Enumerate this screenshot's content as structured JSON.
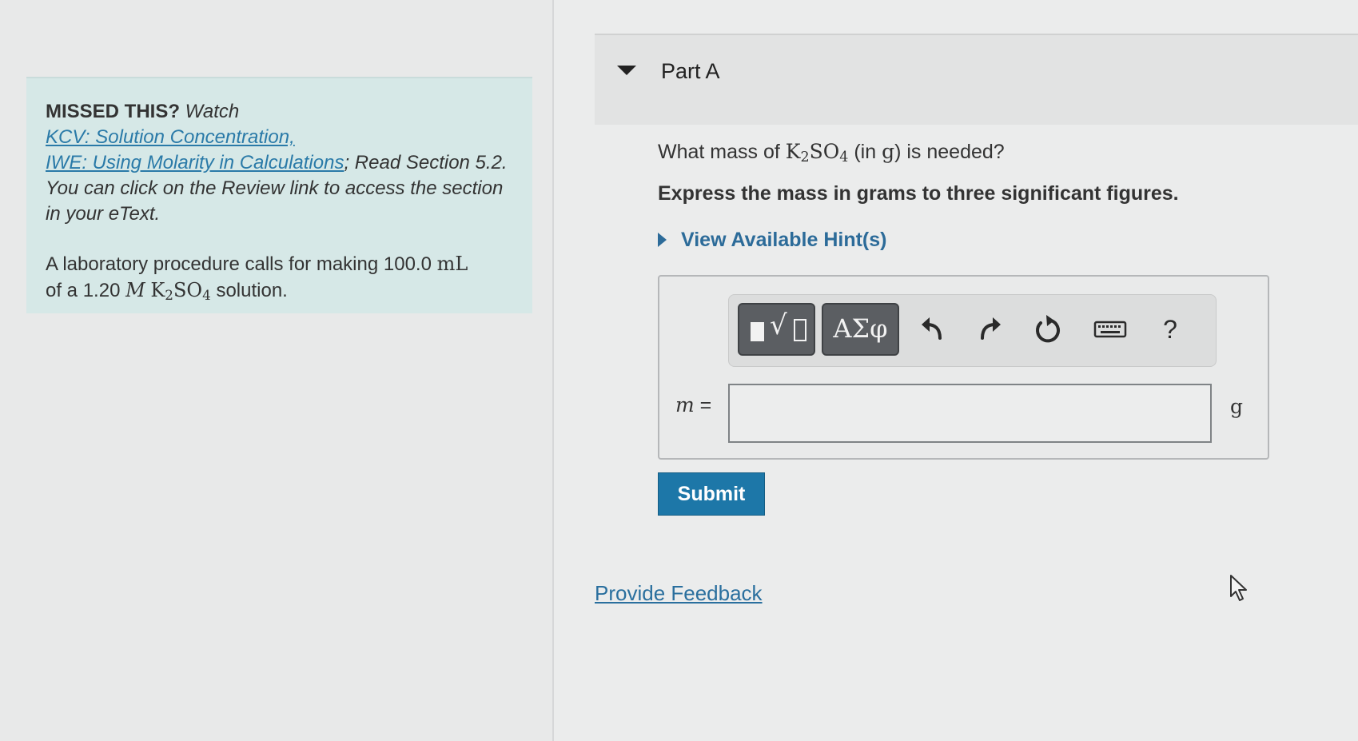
{
  "sidebar": {
    "missed_label": "MISSED THIS?",
    "watch_text": " Watch",
    "link_kcv": "KCV: Solution Concentration,",
    "link_iwe": "IWE: Using Molarity in Calculations",
    "read_section_text": "; Read Section 5.2. You can click on the Review link to access the section in your eText.",
    "problem_prefix": "A laboratory procedure calls for making 100.0",
    "volume_unit": "mL",
    "problem_mid": "of a 1.20",
    "molar_symbol": "M",
    "formula_k": "K",
    "formula_k_sub": "2",
    "formula_so": "SO",
    "formula_so_sub": "4",
    "problem_suffix": "solution."
  },
  "part": {
    "title": "Part A",
    "question_prefix": "What mass of",
    "question_paren_open": "(in",
    "question_unit": "g",
    "question_suffix": ") is needed?",
    "instruction": "Express the mass in grams to three significant figures.",
    "hints_label": "View Available Hint(s)"
  },
  "toolbar": {
    "templates_label": "√",
    "symbols_label": "ΑΣφ",
    "undo_icon": "undo-icon",
    "redo_icon": "redo-icon",
    "reset_icon": "reset-icon",
    "keyboard_icon": "keyboard-icon",
    "help_label": "?"
  },
  "answer": {
    "variable": "m",
    "equals": " =",
    "value": "",
    "unit": "g"
  },
  "submit_label": "Submit",
  "feedback_label": "Provide Feedback",
  "colors": {
    "info_box_bg": "#d6e8e7",
    "link_blue": "#2a7aa8",
    "submit_blue": "#1d77a8",
    "tool_button_dark": "#5b5e62"
  }
}
